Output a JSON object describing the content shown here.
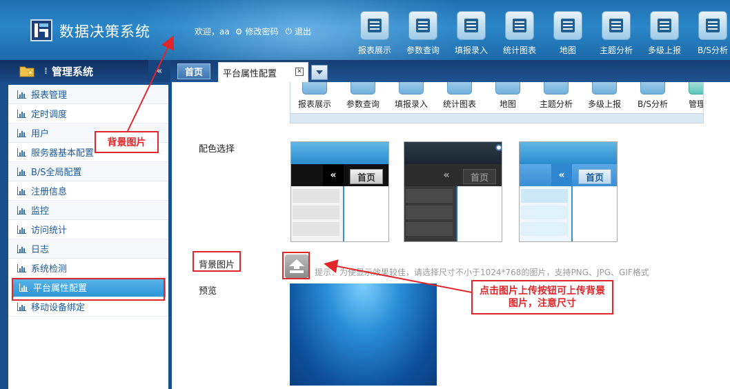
{
  "header": {
    "app_title": "数据决策系统",
    "welcome": "欢迎，aa",
    "change_password": "修改密码",
    "logout": "退出",
    "nav": [
      {
        "label": "报表展示"
      },
      {
        "label": "参数查询"
      },
      {
        "label": "填报录入"
      },
      {
        "label": "统计图表"
      },
      {
        "label": "地图"
      },
      {
        "label": "主题分析"
      },
      {
        "label": "多级上报"
      },
      {
        "label": "B/S分析"
      }
    ]
  },
  "left_panel": {
    "title": "管理系统",
    "collapse_icon": "«",
    "items": [
      {
        "label": "报表管理"
      },
      {
        "label": "定时调度"
      },
      {
        "label": "用户"
      },
      {
        "label": "服务器基本配置"
      },
      {
        "label": "B/S全局配置"
      },
      {
        "label": "注册信息"
      },
      {
        "label": "监控"
      },
      {
        "label": "访问统计"
      },
      {
        "label": "日志"
      },
      {
        "label": "系统检测"
      },
      {
        "label": "平台属性配置",
        "active": true
      },
      {
        "label": "移动设备绑定"
      }
    ]
  },
  "tabs": {
    "home": "首页",
    "active": "平台属性配置"
  },
  "content": {
    "preview_nav": [
      "报表展示",
      "参数查询",
      "填报录入",
      "统计图表",
      "地图",
      "主题分析",
      "多级上报",
      "B/S分析",
      "管理系"
    ],
    "color_label": "配色选择",
    "themes": [
      {
        "name": "black",
        "collapse": "«",
        "home": "首页"
      },
      {
        "name": "dark",
        "collapse": "«",
        "home": "首页",
        "selected": true
      },
      {
        "name": "blue",
        "collapse": "«",
        "home": "首页"
      }
    ],
    "bg_label": "背景图片",
    "upload_hint": "提示：为使显示效果较佳，请选择尺寸不小于1024*768的图片，支持PNG、JPG、GIF格式",
    "preview_label": "预览"
  },
  "annotations": {
    "bg_image": "背景图片",
    "upload_note": "点击图片上传按钮可上传背景图片，注意尺寸"
  },
  "colors": {
    "header_blue": "#2a86c8",
    "active_item": "#2c95d6",
    "annotation_red": "#e0262a"
  }
}
